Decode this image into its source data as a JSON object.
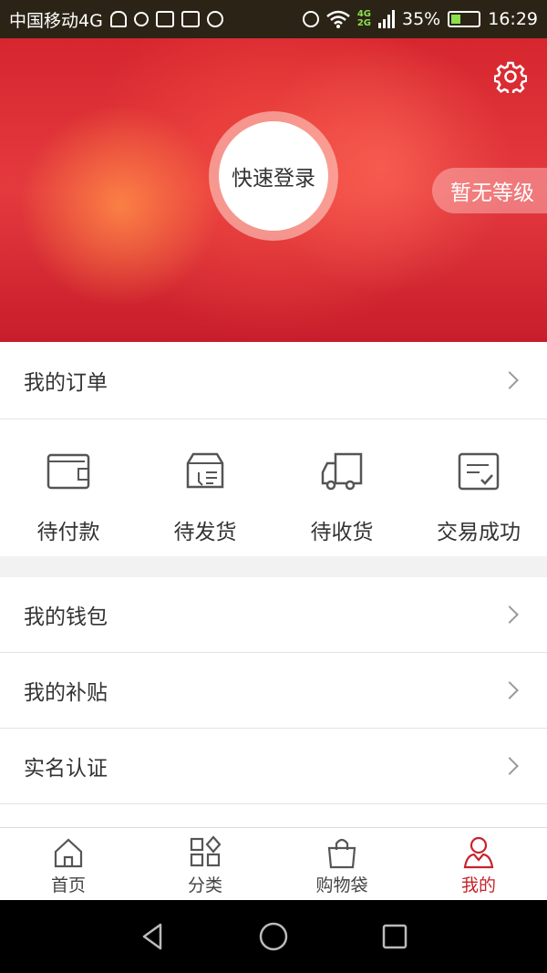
{
  "status_bar": {
    "carrier": "中国移动4G",
    "net_top": "4G",
    "net_bottom": "2G",
    "battery": "35%",
    "time": "16:29"
  },
  "header": {
    "login_label": "快速登录",
    "level_label": "暂无等级",
    "settings_icon": "gear-icon"
  },
  "my_orders": {
    "label": "我的订单"
  },
  "order_statuses": [
    {
      "label": "待付款",
      "icon": "wallet-icon"
    },
    {
      "label": "待发货",
      "icon": "package-icon"
    },
    {
      "label": "待收货",
      "icon": "truck-icon"
    },
    {
      "label": "交易成功",
      "icon": "checklist-icon"
    }
  ],
  "menu": [
    {
      "label": "我的钱包"
    },
    {
      "label": "我的补贴"
    },
    {
      "label": "实名认证"
    }
  ],
  "tabs": [
    {
      "label": "首页",
      "icon": "home-icon"
    },
    {
      "label": "分类",
      "icon": "category-icon"
    },
    {
      "label": "购物袋",
      "icon": "shopping-bag-icon"
    },
    {
      "label": "我的",
      "icon": "user-icon",
      "active": true
    }
  ],
  "colors": {
    "brand": "#c8232c",
    "hero": "#e03a3e"
  }
}
